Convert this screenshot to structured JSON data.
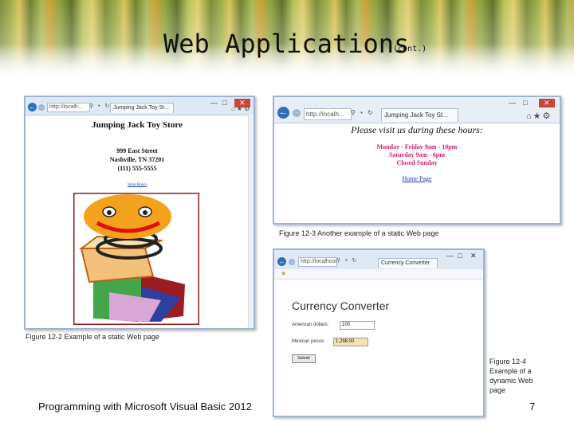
{
  "slide": {
    "title": "Web Applications",
    "title_suffix": "(cont.)",
    "footer": "Programming with Microsoft Visual Basic 2012",
    "page_number": "7"
  },
  "colors": {
    "header_accent": "#9fae46",
    "window_border": "#9fb5cf",
    "pink_text": "#cc2277",
    "link": "#1a3aa8"
  },
  "window1": {
    "address": "http://localh...",
    "tab": "Jumping Jack Toy St...",
    "heading": "Jumping Jack Toy Store",
    "address_line1": "999 East Street",
    "address_line2": "Nashville, TN 37201",
    "phone": "(111) 555-5555",
    "link": "Store Hours"
  },
  "caption1": "Figure 12-2 Example of a static Web page",
  "window2": {
    "address": "http://localh...",
    "tab": "Jumping Jack Toy St...",
    "heading": "Please visit us during these hours:",
    "hours1": "Monday - Friday 9am - 10pm",
    "hours2": "Saturday 9am - 6pm",
    "hours3": "Closed Sunday",
    "link": "Home Page"
  },
  "caption2": "Figure 12-3 Another example of a static Web page",
  "window3": {
    "address": "http://localhost:84",
    "tab": "Currency Converter",
    "heading": "Currency Converter",
    "dollars_label": "American dollars:",
    "dollars_value": "100",
    "pesos_label": "Mexican pesos:",
    "pesos_value": "1,298.00",
    "submit_label": "Submit"
  },
  "caption3": {
    "line1": "Figure 12-4",
    "line2": "Example of a",
    "line3": "dynamic Web",
    "line4": "page"
  }
}
